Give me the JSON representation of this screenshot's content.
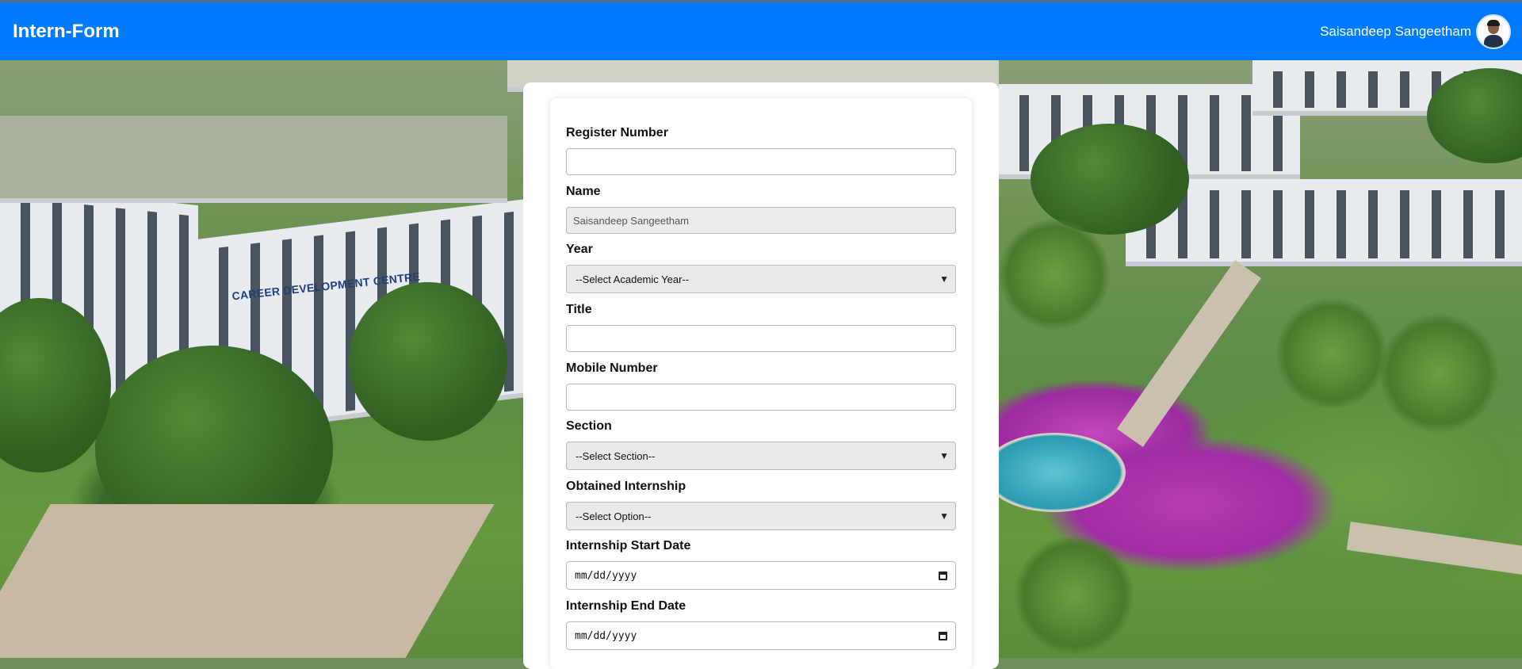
{
  "header": {
    "brand": "Intern-Form",
    "user_name": "Saisandeep Sangeetham",
    "accent_color": "#007bff"
  },
  "background": {
    "sign_text": "CAREER DEVELOPMENT CENTRE"
  },
  "form": {
    "register_number": {
      "label": "Register Number",
      "value": ""
    },
    "name": {
      "label": "Name",
      "value": "Saisandeep Sangeetham"
    },
    "year": {
      "label": "Year",
      "selected": "--Select Academic Year--"
    },
    "title": {
      "label": "Title",
      "value": ""
    },
    "mobile": {
      "label": "Mobile Number",
      "value": ""
    },
    "section": {
      "label": "Section",
      "selected": "--Select Section--"
    },
    "obtained": {
      "label": "Obtained Internship",
      "selected": "--Select Option--"
    },
    "start_date": {
      "label": "Internship Start Date",
      "placeholder": "mm/dd/yyyy"
    },
    "end_date": {
      "label": "Internship End Date",
      "placeholder": "mm/dd/yyyy"
    }
  }
}
